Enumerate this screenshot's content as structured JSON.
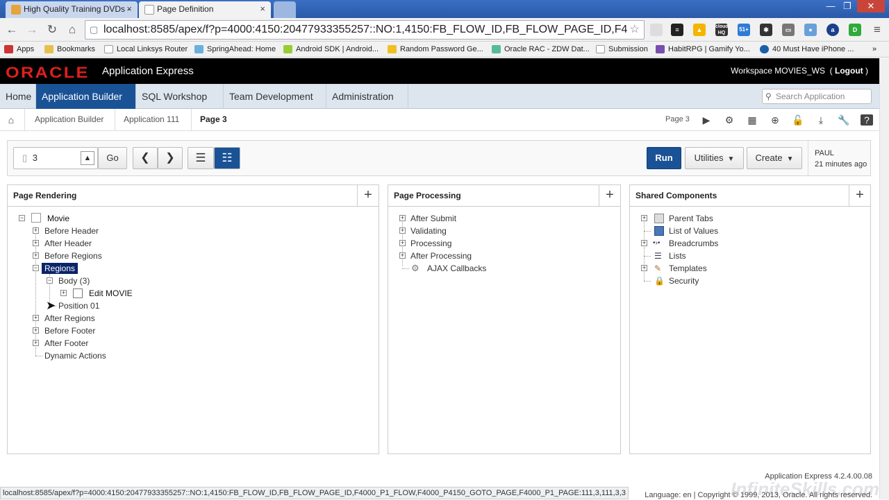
{
  "browser": {
    "tabs": [
      {
        "title": "High Quality Training DVDs -",
        "close": "×"
      },
      {
        "title": "Page Definition",
        "close": "×"
      }
    ],
    "window_controls": [
      "—",
      "❐",
      "✕"
    ],
    "url": "localhost:8585/apex/f?p=4000:4150:20477933355257::NO:1,4150:FB_FLOW_ID,FB_FLOW_PAGE_ID,F4",
    "extensions": {
      "cloud_label": "cloud HQ",
      "badge": "51+"
    },
    "bookmarks": [
      "Apps",
      "Bookmarks",
      "Local Linksys Router",
      "SpringAhead: Home",
      "Android SDK | Android...",
      "Random Password Ge...",
      "Oracle RAC - ZDW Dat...",
      "Submission",
      "HabitRPG | Gamify Yo...",
      "40 Must Have iPhone ..."
    ]
  },
  "apex_header": {
    "logo": "ORACLE",
    "product": "Application Express",
    "workspace": "Workspace MOVIES_WS",
    "logout": "Logout"
  },
  "menu": {
    "items": [
      "Home",
      "Application Builder",
      "SQL Workshop",
      "Team Development",
      "Administration"
    ],
    "active": "Application Builder",
    "search_placeholder": "Search Application"
  },
  "breadcrumb": {
    "items": [
      "Application Builder",
      "Application 111",
      "Page 3"
    ],
    "page_label": "Page 3"
  },
  "controls": {
    "page_number": "3",
    "go": "Go",
    "run": "Run",
    "utilities": "Utilities",
    "create": "Create",
    "user": "PAUL",
    "last_edit": "21 minutes ago"
  },
  "page_rendering": {
    "title": "Page Rendering",
    "root": "Movie",
    "nodes": [
      "Before Header",
      "After Header",
      "Before Regions",
      "Regions",
      "Body (3)",
      "Edit MOVIE",
      "Position 01",
      "After Regions",
      "Before Footer",
      "After Footer",
      "Dynamic Actions"
    ]
  },
  "page_processing": {
    "title": "Page Processing",
    "nodes": [
      "After Submit",
      "Validating",
      "Processing",
      "After Processing",
      "AJAX Callbacks"
    ]
  },
  "shared_components": {
    "title": "Shared Components",
    "nodes": [
      "Parent Tabs",
      "List of Values",
      "Breadcrumbs",
      "Lists",
      "Templates",
      "Security"
    ]
  },
  "footer": {
    "status_url": "localhost:8585/apex/f?p=4000:4150:20477933355257::NO:1,4150:FB_FLOW_ID,FB_FLOW_PAGE_ID,F4000_P1_FLOW,F4000_P4150_GOTO_PAGE,F4000_P1_PAGE:111,3,111,3,3",
    "version": "Application Express 4.2.4.00.08",
    "language": "Language: en | Copyright © 1999, 2013, Oracle. All rights reserved.",
    "watermark": "InfiniteSkills.com"
  },
  "colors": {
    "accent": "#1a5296",
    "oracle_red": "#e01e1e",
    "selection": "#0a246a"
  }
}
